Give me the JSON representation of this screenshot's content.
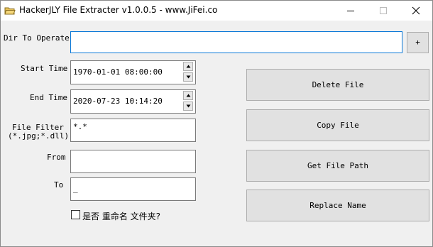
{
  "window": {
    "title": "HackerJLY File Extracter v1.0.0.5 - www.JiFei.co",
    "icons": {
      "app": "folder-app-icon",
      "minimize": "minimize-icon",
      "maximize": "maximize-icon",
      "close": "close-icon"
    }
  },
  "dir": {
    "label": "Dir To Operate",
    "value": "",
    "add_button": "+"
  },
  "start_time": {
    "label": "Start Time",
    "value": "1970-01-01 08:00:00"
  },
  "end_time": {
    "label": "End Time",
    "value": "2020-07-23 10:14:20"
  },
  "file_filter": {
    "label_line1": "File Filter",
    "label_line2": "(*.jpg;*.dll)",
    "value": "*.*"
  },
  "from": {
    "label": "From",
    "value": ""
  },
  "to": {
    "label": "To",
    "value": "_"
  },
  "rename_folder": {
    "label": "是否 重命名 文件夹?",
    "checked": false
  },
  "actions": {
    "delete": "Delete File",
    "copy": "Copy File",
    "get_path": "Get File Path",
    "replace": "Replace Name"
  }
}
